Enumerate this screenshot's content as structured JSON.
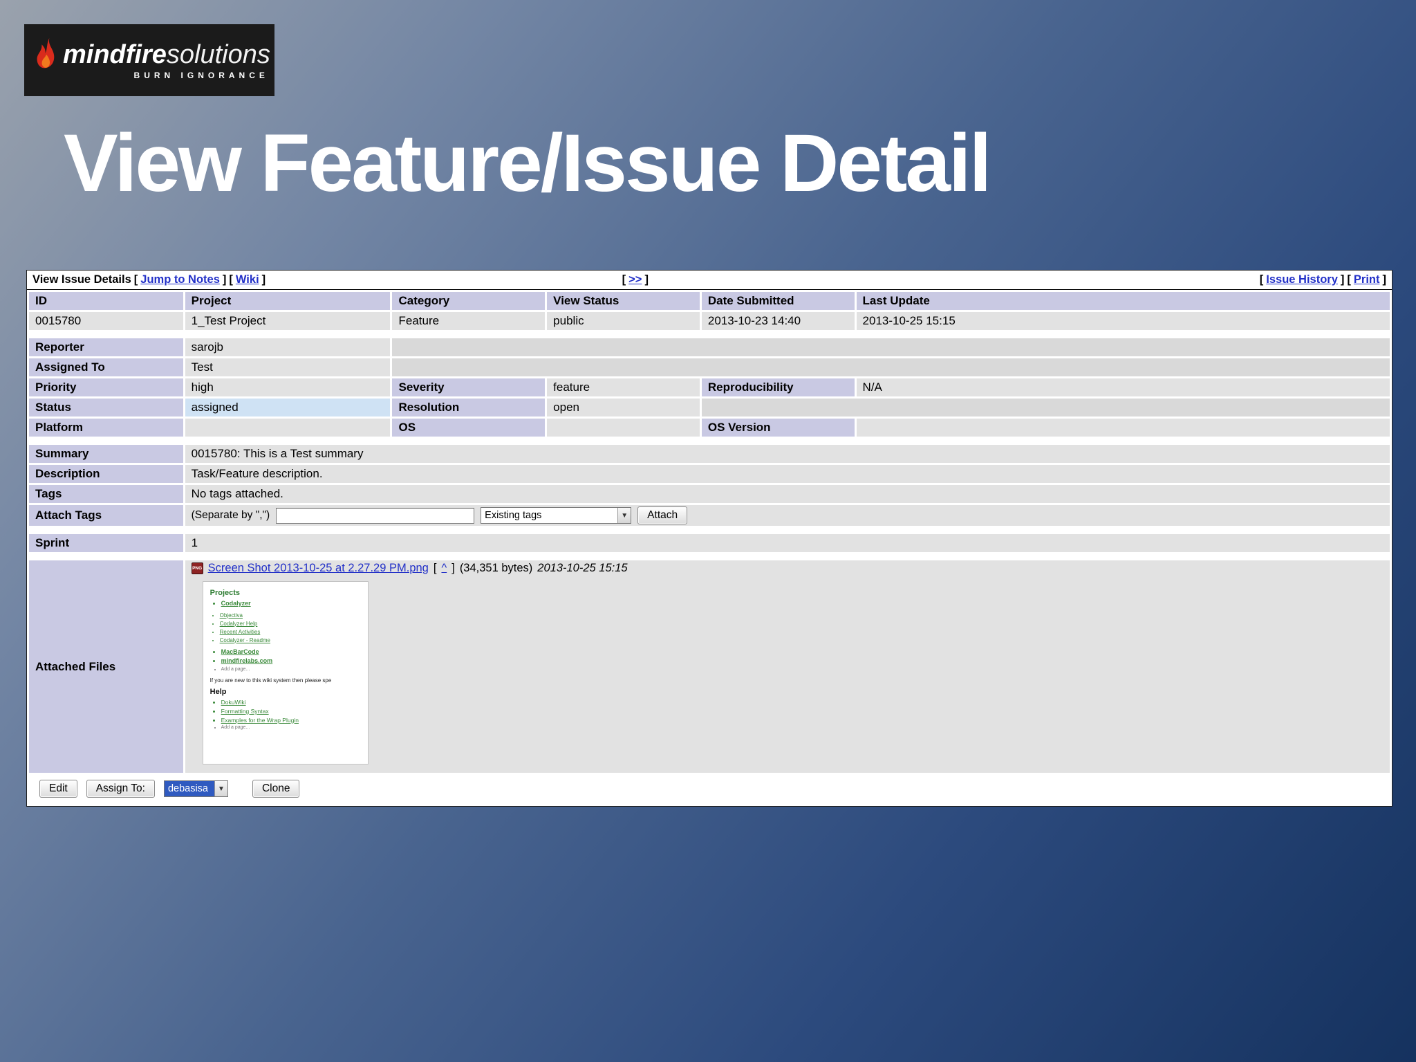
{
  "logo": {
    "brand_bold": "mindfire",
    "brand_light": "solutions",
    "tagline": "BURN IGNORANCE"
  },
  "title": "View Feature/Issue Detail",
  "punct": {
    "lb": "[",
    "rb": "]"
  },
  "titlebar": {
    "heading": "View Issue Details",
    "jump_to_notes": "Jump to Notes",
    "wiki": "Wiki",
    "next": ">>",
    "issue_history": "Issue History",
    "print": "Print"
  },
  "table": {
    "headers": [
      "ID",
      "Project",
      "Category",
      "View Status",
      "Date Submitted",
      "Last Update"
    ],
    "values": [
      "0015780",
      "1_Test Project",
      "Feature",
      "public",
      "2013-10-23 14:40",
      "2013-10-25 15:15"
    ]
  },
  "fields": {
    "reporter_label": "Reporter",
    "reporter_value": "sarojb",
    "assigned_label": "Assigned To",
    "assigned_value": "Test",
    "priority_label": "Priority",
    "priority_value": "high",
    "severity_label": "Severity",
    "severity_value": "feature",
    "reproducibility_label": "Reproducibility",
    "reproducibility_value": "N/A",
    "status_label": "Status",
    "status_value": "assigned",
    "resolution_label": "Resolution",
    "resolution_value": "open",
    "platform_label": "Platform",
    "os_label": "OS",
    "os_version_label": "OS Version",
    "summary_label": "Summary",
    "summary_value": "0015780: This is a Test summary",
    "description_label": "Description",
    "description_value": "Task/Feature description.",
    "tags_label": "Tags",
    "tags_value": "No tags attached.",
    "attach_tags_label": "Attach Tags",
    "separate_hint": "(Separate by \",\")",
    "existing_tags_value": "Existing tags",
    "attach_button": "Attach",
    "sprint_label": "Sprint",
    "sprint_value": "1",
    "attached_files_label": "Attached Files"
  },
  "attachment": {
    "icon_label": "PNG",
    "filename": "Screen Shot 2013-10-25 at 2.27.29 PM.png",
    "anchor": "^",
    "size": "(34,351 bytes)",
    "date": "2013-10-25 15:15"
  },
  "thumbnail": {
    "projects_heading": "Projects",
    "items": [
      "Codalyzer",
      "Objectiva",
      "Codalyzer Help",
      "Recent Activities",
      "Codalyzer - Readme",
      "MacBarCode",
      "mindfirelabs.com"
    ],
    "add_page": "Add a page...",
    "note": "If you are new to this wiki system then please spe",
    "help_heading": "Help",
    "help_items": [
      "DokuWiki",
      "Formatting Syntax",
      "Examples for the Wrap Plugin"
    ],
    "add_page2": "Add a page..."
  },
  "footer": {
    "edit": "Edit",
    "assign_to": "Assign To:",
    "assign_value": "debasisa",
    "clone": "Clone"
  },
  "colors": {
    "label_bg": "#c9c9e3",
    "value_bg": "#e2e2e2",
    "status_assigned_bg": "#cfe2f4",
    "link": "#2230c8",
    "selection_blue": "#2f5ac0",
    "flame_red": "#d92b1c",
    "background_dark_blue": "#15325f"
  }
}
